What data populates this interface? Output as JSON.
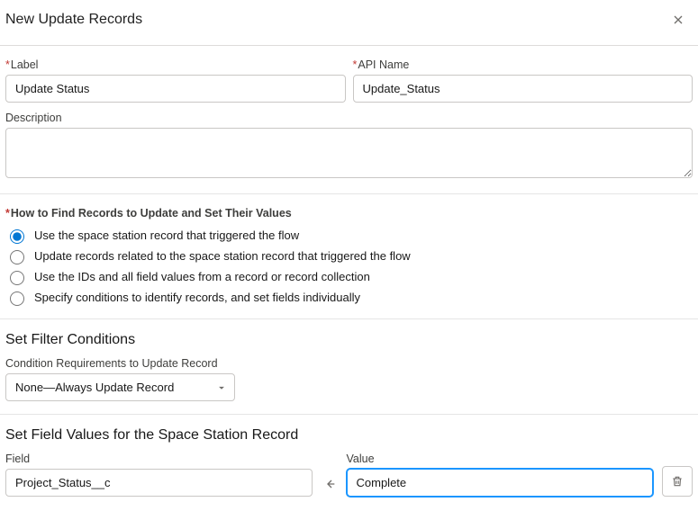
{
  "header": {
    "title": "New Update Records"
  },
  "fields": {
    "label": {
      "label": "Label",
      "value": "Update Status"
    },
    "apiName": {
      "label": "API Name",
      "value": "Update_Status"
    },
    "description": {
      "label": "Description",
      "value": ""
    }
  },
  "findSection": {
    "heading": "How to Find Records to Update and Set Their Values",
    "options": [
      "Use the space station record that triggered the flow",
      "Update records related to the space station record that triggered the flow",
      "Use the IDs and all field values from a record or record collection",
      "Specify conditions to identify records, and set fields individually"
    ],
    "selectedIndex": 0
  },
  "filterSection": {
    "title": "Set Filter Conditions",
    "conditionLabel": "Condition Requirements to Update Record",
    "conditionValue": "None—Always Update Record"
  },
  "valuesSection": {
    "title": "Set Field Values for the Space Station Record",
    "fieldLabel": "Field",
    "valueLabel": "Value",
    "fieldValue": "Project_Status__c",
    "valueValue": "Complete"
  }
}
